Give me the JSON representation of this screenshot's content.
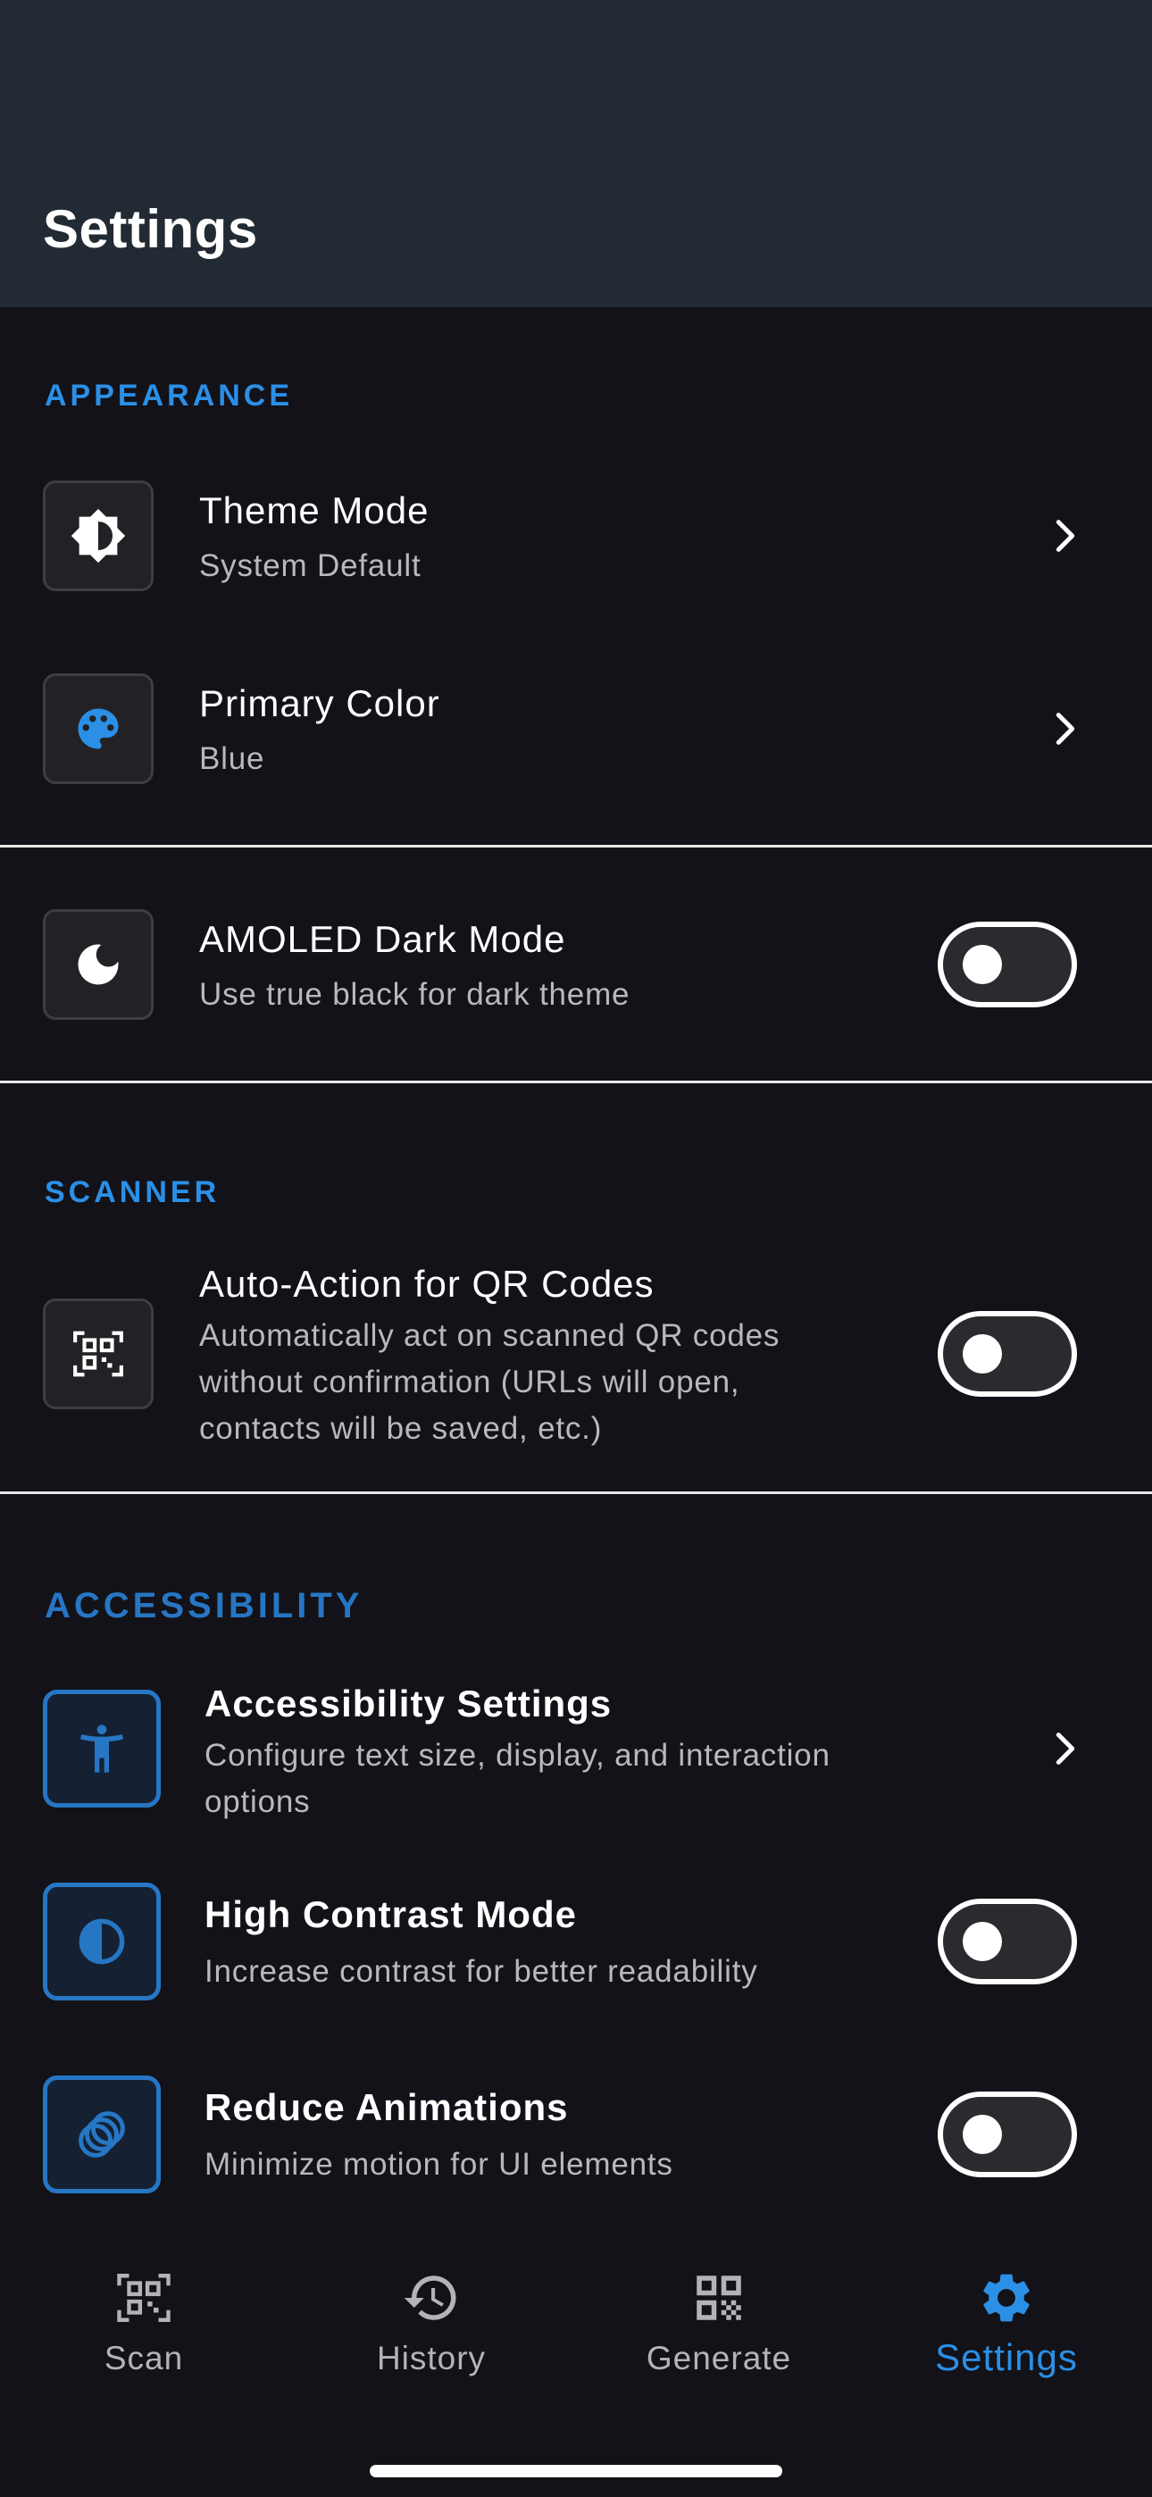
{
  "header": {
    "title": "Settings"
  },
  "sections": {
    "appearance": "APPEARANCE",
    "scanner": "SCANNER",
    "accessibility": "ACCESSIBILITY"
  },
  "rows": {
    "theme_mode": {
      "title": "Theme Mode",
      "subtitle": "System Default",
      "icon": "brightness-icon"
    },
    "primary_color": {
      "title": "Primary Color",
      "subtitle": "Blue",
      "icon": "palette-icon"
    },
    "amoled": {
      "title": "AMOLED Dark Mode",
      "subtitle": "Use true black for dark theme",
      "icon": "moon-icon",
      "enabled": false
    },
    "auto_action": {
      "title": "Auto-Action for QR Codes",
      "subtitle_lines": [
        "Automatically act on scanned QR codes",
        "without confirmation (URLs will open,",
        "contacts will be saved, etc.)"
      ],
      "icon": "qr-scan-icon",
      "enabled": false
    },
    "accessibility_settings": {
      "title": "Accessibility Settings",
      "subtitle_lines": [
        "Configure text size, display, and interaction",
        "options"
      ],
      "icon": "accessibility-icon"
    },
    "high_contrast": {
      "title": "High Contrast Mode",
      "subtitle": "Increase contrast for better readability",
      "icon": "contrast-icon",
      "enabled": false
    },
    "reduce_animations": {
      "title": "Reduce Animations",
      "subtitle": "Minimize motion for UI elements",
      "icon": "animation-icon",
      "enabled": false
    }
  },
  "tabbar": {
    "items": [
      {
        "label": "Scan",
        "icon": "qr-scan-icon",
        "active": false
      },
      {
        "label": "History",
        "icon": "history-icon",
        "active": false
      },
      {
        "label": "Generate",
        "icon": "qr-code-icon",
        "active": false
      },
      {
        "label": "Settings",
        "icon": "gear-icon",
        "active": true
      }
    ]
  },
  "colors": {
    "accent": "#2b8fe6",
    "accent_dim": "#2676c4",
    "header_bg": "#222a33",
    "page_bg": "#131218"
  }
}
